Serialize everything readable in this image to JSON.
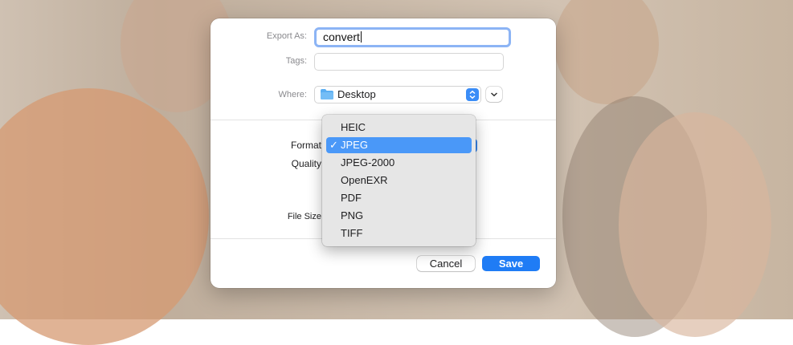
{
  "dialog": {
    "export_as_label": "Export As:",
    "export_as_value": "convert",
    "tags_label": "Tags:",
    "where_label": "Where:",
    "where_value": "Desktop",
    "format_label": "Format",
    "quality_label": "Quality",
    "file_size_label": "File Size",
    "cancel_label": "Cancel",
    "save_label": "Save"
  },
  "format_menu": {
    "selected": "JPEG",
    "check_glyph": "✓",
    "items": [
      "HEIC",
      "JPEG",
      "JPEG-2000",
      "OpenEXR",
      "PDF",
      "PNG",
      "TIFF"
    ]
  },
  "colors": {
    "accent": "#1f7cf5",
    "menu_highlight": "#4a98f8",
    "focus_ring": "#8cb4f5"
  }
}
